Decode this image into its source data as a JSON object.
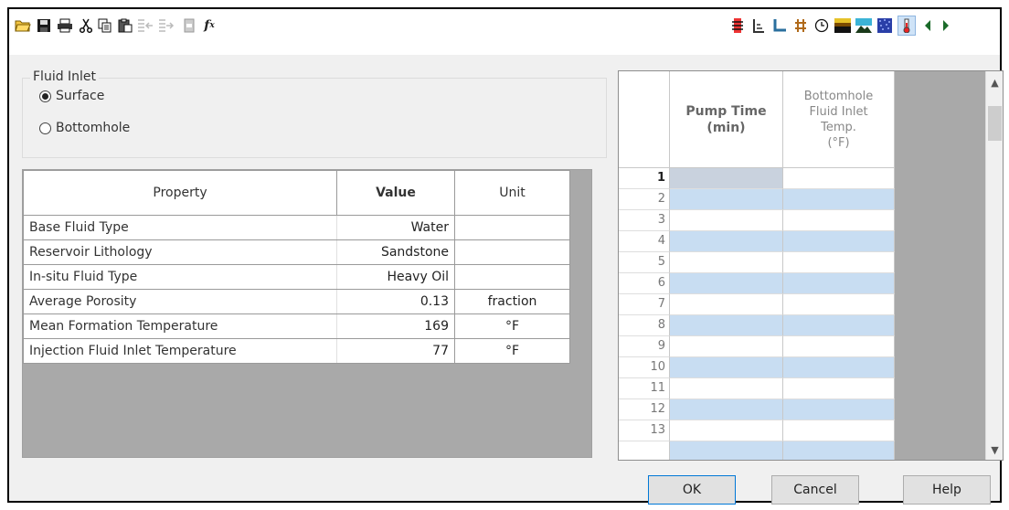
{
  "toolbar": {
    "left_icons": [
      "open-folder-icon",
      "save-icon",
      "print-icon",
      "cut-icon",
      "copy-icon",
      "paste-icon",
      "insert-row-icon",
      "append-row-icon",
      "delete-row-icon",
      "function-icon"
    ],
    "right_icons": [
      "pump-icon",
      "well-schematic-icon",
      "pipe-icon",
      "grid-hash-icon",
      "clock-icon",
      "formation-icon",
      "reservoir-icon",
      "pattern-icon",
      "thermometer-icon",
      "arrow-left-icon",
      "arrow-right-icon"
    ],
    "function_glyph": "f",
    "function_sub": "x"
  },
  "fluid_inlet": {
    "title": "Fluid Inlet",
    "options": [
      {
        "label": "Surface",
        "selected": true
      },
      {
        "label": "Bottomhole",
        "selected": false
      }
    ]
  },
  "property_table": {
    "headers": {
      "property": "Property",
      "value": "Value",
      "unit": "Unit"
    },
    "rows": [
      {
        "property": "Base Fluid Type",
        "value": "Water",
        "unit": ""
      },
      {
        "property": "Reservoir Lithology",
        "value": "Sandstone",
        "unit": ""
      },
      {
        "property": "In-situ Fluid Type",
        "value": "Heavy Oil",
        "unit": ""
      },
      {
        "property": "Average Porosity",
        "value": "0.13",
        "unit": "fraction"
      },
      {
        "property": "Mean Formation Temperature",
        "value": "169",
        "unit": "°F"
      },
      {
        "property": "Injection Fluid Inlet Temperature",
        "value": "77",
        "unit": "°F"
      }
    ]
  },
  "data_grid": {
    "col_pump_line1": "Pump Time",
    "col_pump_line2": "(min)",
    "col_bh_line1": "Bottomhole",
    "col_bh_line2": "Fluid Inlet",
    "col_bh_line3": "Temp.",
    "col_bh_line4": "(°F)",
    "row_numbers": [
      "1",
      "2",
      "3",
      "4",
      "5",
      "6",
      "7",
      "8",
      "9",
      "10",
      "11",
      "12",
      "13"
    ]
  },
  "buttons": {
    "ok": "OK",
    "cancel": "Cancel",
    "help": "Help"
  },
  "colors": {
    "stripe": "#c8ddf2",
    "panel_gray": "#a9a9a9",
    "ok_border": "#0078d7"
  }
}
